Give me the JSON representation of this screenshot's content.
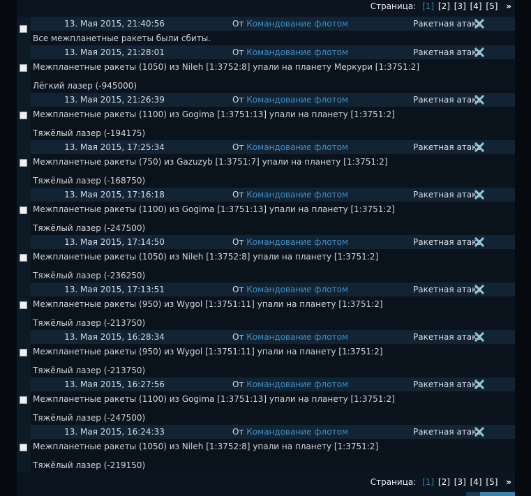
{
  "pager": {
    "label": "Страница:",
    "pages": [
      "[1]",
      "[2]",
      "[3]",
      "[4]",
      "[5]"
    ],
    "current_index": 0,
    "next": "»"
  },
  "from_prefix": "От",
  "colors": {
    "link": "#3d8fc7",
    "current_page": "#3a7fa0",
    "header_bg": "#122333"
  },
  "icons": {
    "delete": "x-delete-icon"
  },
  "messages": [
    {
      "date": "13. Мая 2015, 21:40:56",
      "sender": "Командование флотом",
      "subject": "Ракетная атака",
      "text": "Все межпланетные ракеты были сбиты.",
      "result": ""
    },
    {
      "date": "13. Мая 2015, 21:28:01",
      "sender": "Командование флотом",
      "subject": "Ракетная атака",
      "text": "Межпланетные ракеты (1050) из Nileh [1:3752:8] упали на планету Меркури [1:3751:2]",
      "result": "Лёгкий лазер (-945000)"
    },
    {
      "date": "13. Мая 2015, 21:26:39",
      "sender": "Командование флотом",
      "subject": "Ракетная атака",
      "text": "Межпланетные ракеты (1100) из Gogima [1:3751:13] упали на планету [1:3751:2]",
      "result": "Тяжёлый лазер (-194175)"
    },
    {
      "date": "13. Мая 2015, 17:25:34",
      "sender": "Командование флотом",
      "subject": "Ракетная атака",
      "text": "Межпланетные ракеты (750) из Gazuzyb [1:3751:7] упали на планету [1:3751:2]",
      "result": "Тяжёлый лазер (-168750)"
    },
    {
      "date": "13. Мая 2015, 17:16:18",
      "sender": "Командование флотом",
      "subject": "Ракетная атака",
      "text": "Межпланетные ракеты (1100) из Gogima [1:3751:13] упали на планету [1:3751:2]",
      "result": "Тяжёлый лазер (-247500)"
    },
    {
      "date": "13. Мая 2015, 17:14:50",
      "sender": "Командование флотом",
      "subject": "Ракетная атака",
      "text": "Межпланетные ракеты (1050) из Nileh [1:3752:8] упали на планету [1:3751:2]",
      "result": "Тяжёлый лазер (-236250)"
    },
    {
      "date": "13. Мая 2015, 17:13:51",
      "sender": "Командование флотом",
      "subject": "Ракетная атака",
      "text": "Межпланетные ракеты (950) из Wygol [1:3751:11] упали на планету [1:3751:2]",
      "result": "Тяжёлый лазер (-213750)"
    },
    {
      "date": "13. Мая 2015, 16:28:34",
      "sender": "Командование флотом",
      "subject": "Ракетная атака",
      "text": "Межпланетные ракеты (950) из Wygol [1:3751:11] упали на планету [1:3751:2]",
      "result": "Тяжёлый лазер (-213750)"
    },
    {
      "date": "13. Мая 2015, 16:27:56",
      "sender": "Командование флотом",
      "subject": "Ракетная атака",
      "text": "Межпланетные ракеты (1100) из Gogima [1:3751:13] упали на планету [1:3751:2]",
      "result": "Тяжёлый лазер (-247500)"
    },
    {
      "date": "13. Мая 2015, 16:24:33",
      "sender": "Командование флотом",
      "subject": "Ракетная атака",
      "text": "Межпланетные ракеты (1050) из Nileh [1:3752:8] упали на планету [1:3751:2]",
      "result": "Тяжёлый лазер (-219150)"
    }
  ]
}
